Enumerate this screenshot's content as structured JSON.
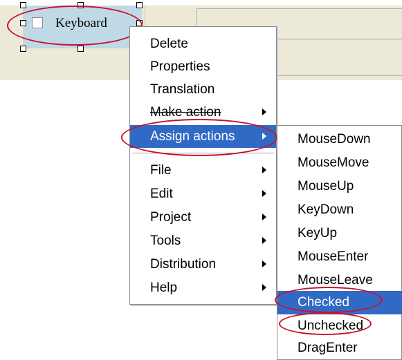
{
  "designer": {
    "checkbox_label": "Keyboard"
  },
  "context_menu": {
    "items": [
      {
        "label": "Delete",
        "submenu": false
      },
      {
        "label": "Properties",
        "submenu": false
      },
      {
        "label": "Translation",
        "submenu": false
      },
      {
        "label": "Make action",
        "submenu": true
      },
      {
        "label": "Assign actions",
        "submenu": true,
        "highlighted": true
      },
      {
        "label": "File",
        "submenu": true
      },
      {
        "label": "Edit",
        "submenu": true
      },
      {
        "label": "Project",
        "submenu": true
      },
      {
        "label": "Tools",
        "submenu": true
      },
      {
        "label": "Distribution",
        "submenu": true
      },
      {
        "label": "Help",
        "submenu": true
      }
    ]
  },
  "submenu": {
    "items": [
      {
        "label": "MouseDown"
      },
      {
        "label": "MouseMove"
      },
      {
        "label": "MouseUp"
      },
      {
        "label": "KeyDown"
      },
      {
        "label": "KeyUp"
      },
      {
        "label": "MouseEnter"
      },
      {
        "label": "MouseLeave"
      },
      {
        "label": "Checked",
        "highlighted": true
      },
      {
        "label": "Unchecked"
      },
      {
        "label": "DragEnter"
      }
    ]
  },
  "colors": {
    "highlight": "#316ac5",
    "annotation_ellipse": "#c8102e",
    "selection": "#bfd9e6",
    "surface": "#ece9d8"
  },
  "icons": [
    "submenu-arrow-icon",
    "checkbox-icon"
  ]
}
